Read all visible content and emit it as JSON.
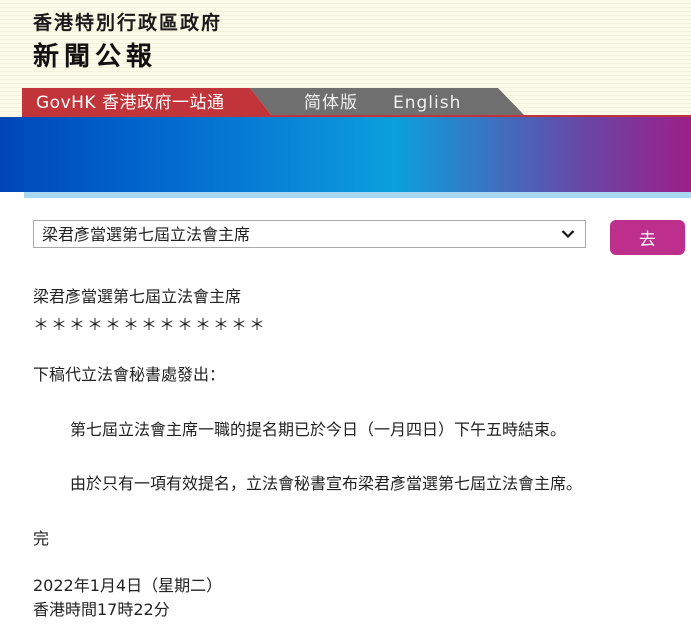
{
  "header": {
    "organization": "香港特別行政區政府",
    "publication": "新聞公報"
  },
  "nav": {
    "govhk_label": "GovHK 香港政府一站通",
    "simplified_label": "简体版",
    "english_label": "English"
  },
  "colors": {
    "govhk_tab": "#c0343a",
    "lang_tab": "#6f6f6f",
    "go_button": "#be2f8d"
  },
  "selector": {
    "selected_value": "梁君彥當選第七屆立法會主席",
    "go_label": "去"
  },
  "article": {
    "title": "梁君彥當選第七屆立法會主席",
    "separator": "＊＊＊＊＊＊＊＊＊＊＊＊＊",
    "intro": "下稿代立法會秘書處發出：",
    "paragraphs": [
      "第七屆立法會主席一職的提名期已於今日（一月四日）下午五時結束。",
      "由於只有一項有效提名，立法會秘書宣布梁君彥當選第七屆立法會主席。"
    ],
    "end_mark": "完",
    "date": "2022年1月4日（星期二）",
    "time": "香港時間17時22分"
  }
}
